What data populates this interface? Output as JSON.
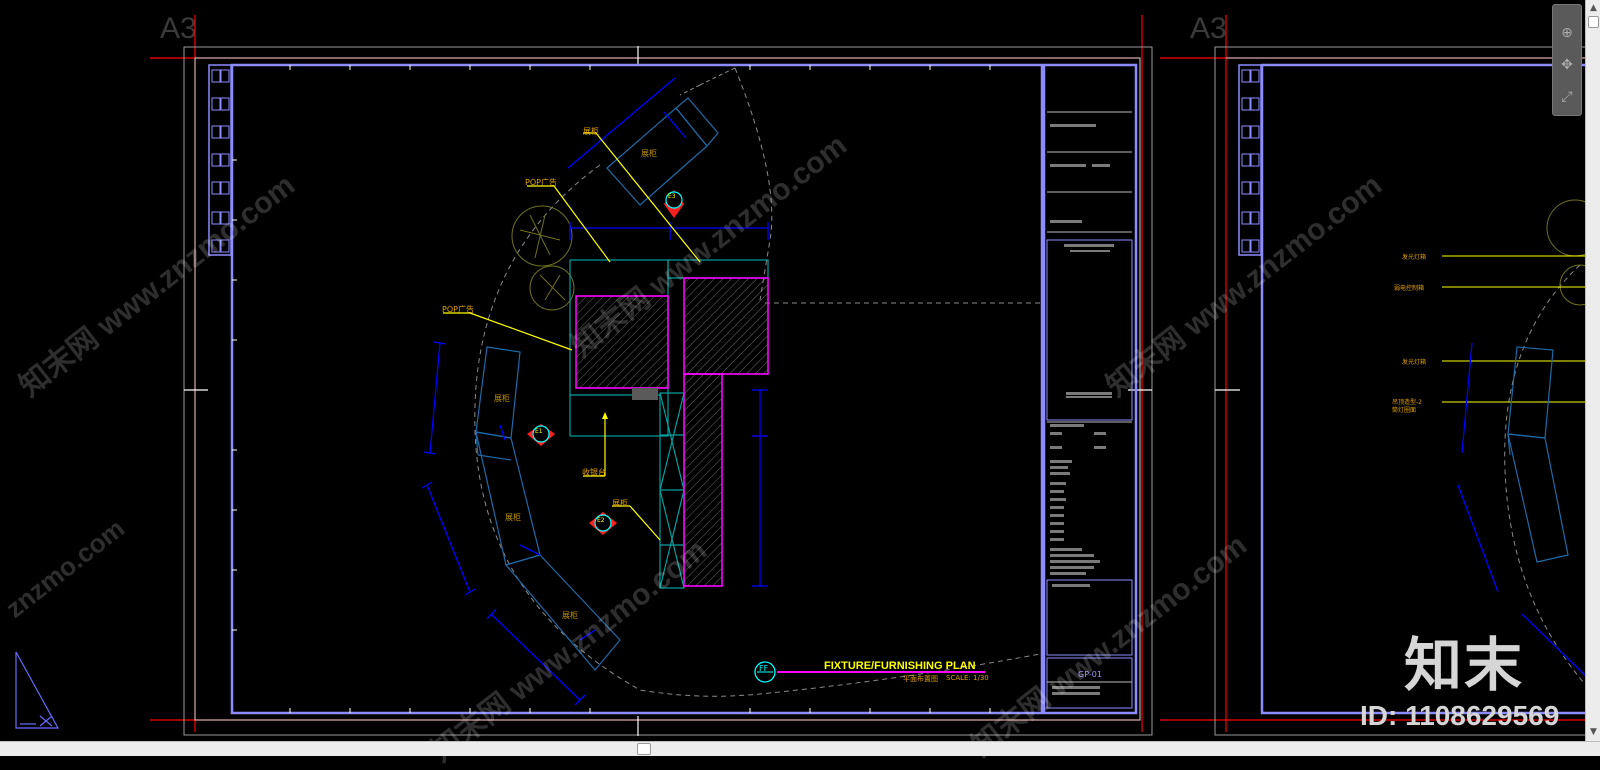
{
  "sheets": [
    {
      "label": "A3"
    },
    {
      "label": "A3"
    }
  ],
  "drawing": {
    "title": "FIXTURE/FURNISHING PLAN",
    "subtitle": "平面布置图",
    "scale": "SCALE: 1/30",
    "symbol": "FF",
    "sheet_no": "GP-01",
    "labels": {
      "pop1": "POP广告",
      "pop2": "POP广告",
      "display_top": "展柜",
      "display_top_inner": "展柜",
      "display_left": "展柜",
      "display_bottom": "展柜",
      "display_bottom2": "展柜",
      "counter": "收银台",
      "display_right": "展柜",
      "e1": "E1",
      "e2": "E2",
      "e3": "E3"
    }
  },
  "drawing2": {
    "labels": {
      "l1": "发光灯箱",
      "l2": "弱电控制箱",
      "l3": "发光灯箱",
      "l4": "吊顶造型-2",
      "l4b": "筒灯圈面"
    }
  },
  "watermark": {
    "text": "知末网 www.znzmo.com",
    "brand": "知末",
    "id": "ID: 1108629569"
  },
  "colors": {
    "frame": "#8c8cff",
    "red": "#ff0000",
    "magenta": "#ff00ff",
    "cyan": "#00a0a0",
    "yellow": "#ffff00",
    "blue": "#0000ff"
  },
  "ui": {
    "nav_icons": [
      "zoom-icon",
      "pan-icon",
      "orbit-icon"
    ]
  }
}
